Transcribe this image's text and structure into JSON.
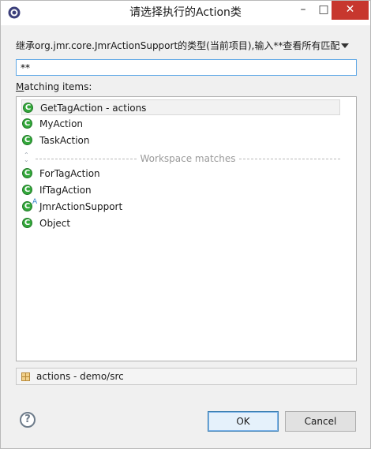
{
  "window": {
    "title": "请选择执行的Action类",
    "minimize_glyph": "–",
    "maximize_glyph": "□",
    "close_glyph": "✕"
  },
  "description": "继承org.jmr.core.JmrActionSupport的类型(当前项目),输入**查看所有匹配",
  "filter": {
    "value": "**"
  },
  "matching_label": {
    "mnemonic": "M",
    "rest": "atching items:"
  },
  "items": [
    {
      "label": "GetTagAction - actions",
      "icon": "class-icon",
      "selected": true
    },
    {
      "label": "MyAction",
      "icon": "class-icon"
    },
    {
      "label": "TaskAction",
      "icon": "class-icon"
    }
  ],
  "separator": {
    "label": "Workspace matches",
    "icon": "separator-icon"
  },
  "workspace_items": [
    {
      "label": "ForTagAction",
      "icon": "class-icon"
    },
    {
      "label": "IfTagAction",
      "icon": "class-icon"
    },
    {
      "label": "JmrActionSupport",
      "icon": "abstract-class-icon",
      "abstract_mark": "A"
    },
    {
      "label": "Object",
      "icon": "class-icon"
    }
  ],
  "class_icon_letter": "C",
  "status": {
    "text": "actions - demo/src",
    "icon": "package-icon"
  },
  "buttons": {
    "help": "?",
    "ok": "OK",
    "cancel": "Cancel"
  },
  "colors": {
    "close_button": "#c7372e",
    "input_border": "#5fa8e6",
    "class_icon": "#33a83b"
  }
}
